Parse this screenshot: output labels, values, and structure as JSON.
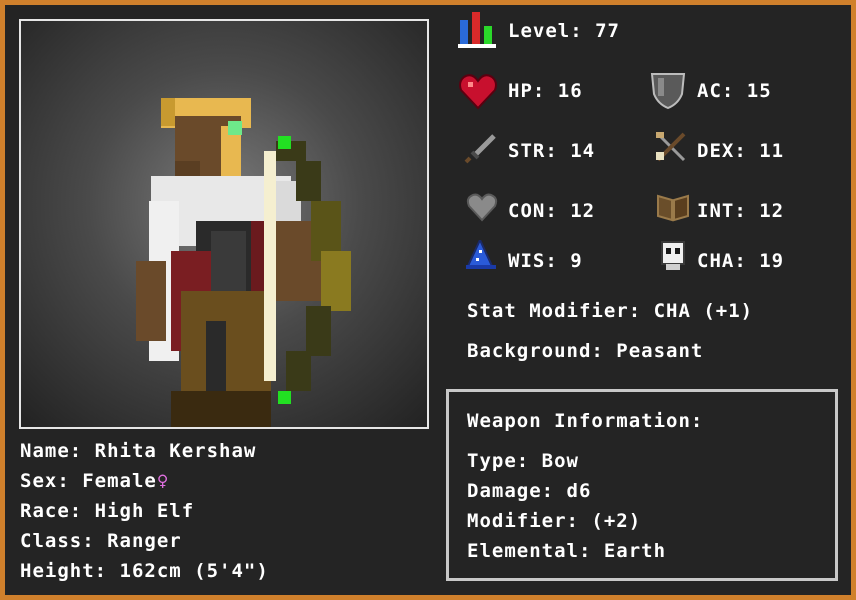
{
  "character": {
    "name_line": "Name: Rhita Kershaw",
    "sex_line": "Sex: Female",
    "sex_symbol": "♀",
    "race_line": "Race: High Elf",
    "class_line": "Class: Ranger",
    "height_line": "Height: 162cm (5'4\")"
  },
  "level": {
    "text": "Level: 77"
  },
  "stats": {
    "hp": "HP: 16",
    "ac": "AC: 15",
    "str": "STR: 14",
    "dex": "DEX: 11",
    "con": "CON: 12",
    "int": "INT: 12",
    "wis": "WIS: 9",
    "cha": "CHA: 19"
  },
  "stat_modifier": "Stat Modifier: CHA (+1)",
  "background": "Background: Peasant",
  "weapon": {
    "heading": "Weapon Information:",
    "type": "Type: Bow",
    "damage": "Damage: d6",
    "modifier": "Modifier: (+2)",
    "elemental": "Elemental: Earth"
  },
  "colors": {
    "frame": "#d0802c",
    "background": "#242424",
    "female_symbol": "#e070e0",
    "heart": "#c8102e"
  },
  "icons": [
    "level-bars-icon",
    "heart-icon",
    "shield-icon",
    "sword-icon",
    "crossbow-icon",
    "gray-heart-icon",
    "book-icon",
    "wizard-hat-icon",
    "skull-mask-icon"
  ]
}
